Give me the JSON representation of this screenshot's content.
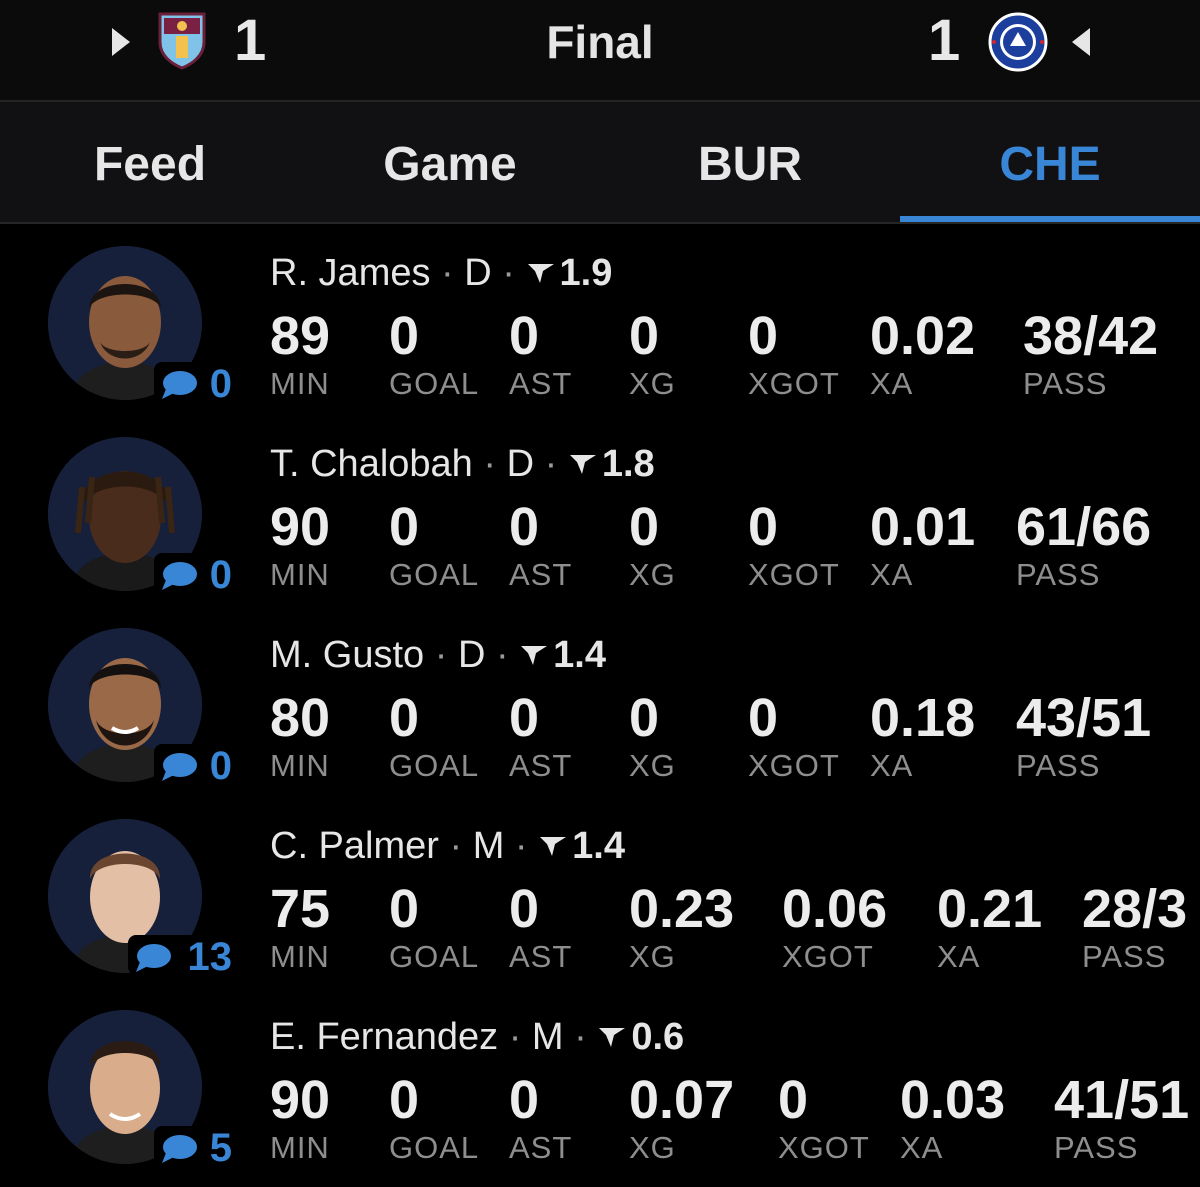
{
  "header": {
    "home_score": "1",
    "away_score": "1",
    "status": "Final",
    "home_crest_icon": "burnley-crest-icon",
    "away_crest_icon": "chelsea-crest-icon"
  },
  "tabs": [
    {
      "label": "Feed",
      "active": false
    },
    {
      "label": "Game",
      "active": false
    },
    {
      "label": "BUR",
      "active": false
    },
    {
      "label": "CHE",
      "active": true
    }
  ],
  "accent_color": "#3a86d6",
  "stat_labels": {
    "min": "MIN",
    "goal": "GOAL",
    "ast": "AST",
    "xg": "XG",
    "xgot": "XGOT",
    "xa": "XA",
    "pass": "PASS"
  },
  "players": [
    {
      "name": "R. James",
      "position": "D",
      "rating": "1.9",
      "comments": "0",
      "min": "89",
      "goal": "0",
      "ast": "0",
      "xg": "0",
      "xgot": "0",
      "xa": "0.02",
      "pass": "38/42"
    },
    {
      "name": "T. Chalobah",
      "position": "D",
      "rating": "1.8",
      "comments": "0",
      "min": "90",
      "goal": "0",
      "ast": "0",
      "xg": "0",
      "xgot": "0",
      "xa": "0.01",
      "pass": "61/66"
    },
    {
      "name": "M. Gusto",
      "position": "D",
      "rating": "1.4",
      "comments": "0",
      "min": "80",
      "goal": "0",
      "ast": "0",
      "xg": "0",
      "xgot": "0",
      "xa": "0.18",
      "pass": "43/51"
    },
    {
      "name": "C. Palmer",
      "position": "M",
      "rating": "1.4",
      "comments": "13",
      "min": "75",
      "goal": "0",
      "ast": "0",
      "xg": "0.23",
      "xgot": "0.06",
      "xa": "0.21",
      "pass": "28/3"
    },
    {
      "name": "E. Fernandez",
      "position": "M",
      "rating": "0.6",
      "comments": "5",
      "min": "90",
      "goal": "0",
      "ast": "0",
      "xg": "0.07",
      "xgot": "0",
      "xa": "0.03",
      "pass": "41/51"
    }
  ]
}
